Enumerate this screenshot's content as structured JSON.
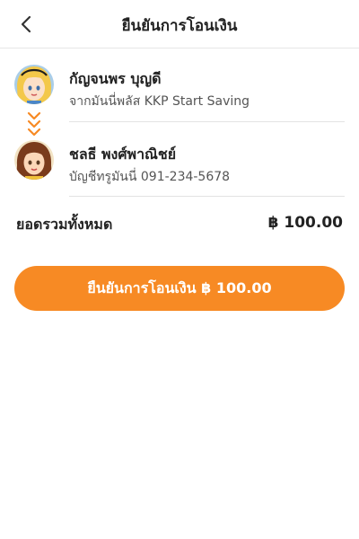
{
  "header": {
    "title": "ยืนยันการโอนเงิน",
    "back_icon": "chevron-left-icon"
  },
  "sender": {
    "name": "กัญจนพร บุญดี",
    "account": "จากมันนี่พลัส KKP Start Saving",
    "avatar_icon": "avatar-blonde-girl"
  },
  "transfer_indicator_icon": "double-chevron-down-icon",
  "recipient": {
    "name": "ชลธี พงศ์พาณิชย์",
    "account": "บัญชีทรูมันนี่ 091-234-5678",
    "avatar_icon": "avatar-brunette-woman"
  },
  "summary": {
    "total_label": "ยอดรวมทั้งหมด",
    "total_value": "฿ 100.00"
  },
  "confirm_button": {
    "label": "ยืนยันการโอนเงิน ฿ 100.00"
  },
  "colors": {
    "accent": "#f78a24",
    "text": "#222222",
    "subtext": "#555555",
    "divider": "#e3e3e3"
  }
}
